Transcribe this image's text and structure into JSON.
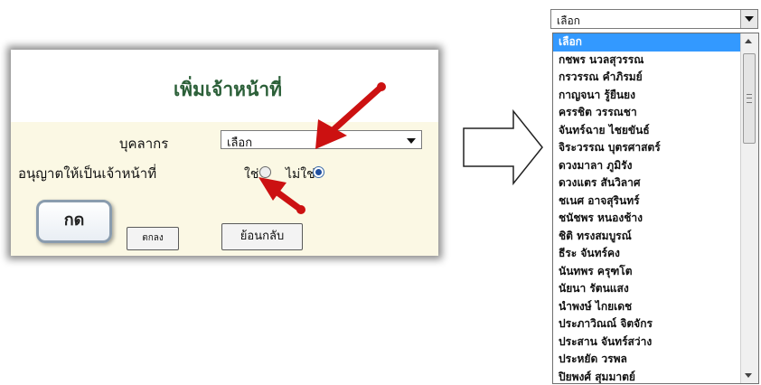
{
  "form": {
    "title": "เพิ่มเจ้าหน้าที่",
    "person_label": "บุคลากร",
    "person_select_value": "เลือก",
    "allow_label": "อนุญาตให้เป็นเจ้าหน้าที่",
    "radio_yes_label": "ใช่",
    "radio_no_label": "ไม่ใช่",
    "selected_radio": "ไม่ใช่",
    "ok_button": "ตกลง",
    "back_button": "ย้อนกลับ"
  },
  "callout": {
    "text": "กด"
  },
  "dropdown": {
    "selected_value": "เลือก",
    "items": [
      "เลือก",
      "กชพร นวลสุวรรณ",
      "กรวรรณ คำภิรมย์",
      "กาญจนา รู้ยืนยง",
      "ครรชิต วรรณชา",
      "จันทร์ฉาย ไชยขันธ์",
      "จิระวรรณ บุตรศาสตร์",
      "ดวงมาลา ภูมิรัง",
      "ดวงแตร สันวิลาศ",
      "ชเนศ อาจสุรินทร์",
      "ชนัชพร หนองช้าง",
      "ชิติ ทรงสมบูรณ์",
      "ธีระ จันทร์คง",
      "นันทพร ครุฑโต",
      "นัยนา รัตนแสง",
      "นำพงษ์ ไกยเดช",
      "ประภาวิณณ์ จิตจักร",
      "ประสาน จันทร์สว่าง",
      "ประหยัด วรพล",
      "ปิยพงศ์ สุมมาตย์"
    ]
  },
  "colors": {
    "title_green": "#2b5f38",
    "panel_bg": "#fbf8e4",
    "arrow_red": "#cc1111",
    "selection_blue": "#3399ff"
  }
}
